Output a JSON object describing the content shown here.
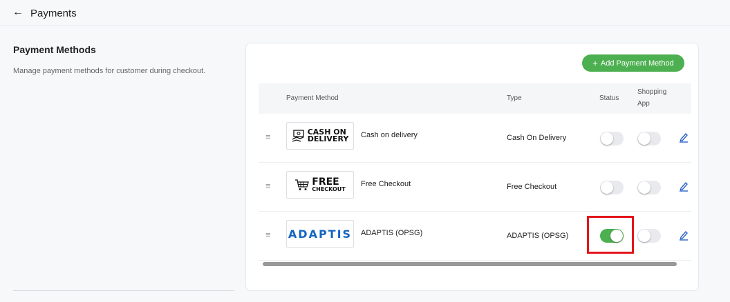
{
  "header": {
    "back_icon": "arrow-left-icon",
    "title": "Payments"
  },
  "sidebar": {
    "title": "Payment Methods",
    "description": "Manage payment methods for customer during checkout."
  },
  "toolbar": {
    "add_label": "Add Payment Method",
    "add_icon": "plus-icon"
  },
  "table": {
    "headers": {
      "method": "Payment Method",
      "type": "Type",
      "status": "Status",
      "shopping_app_line1": "Shopping",
      "shopping_app_line2": "App"
    },
    "rows": [
      {
        "logo_line1": "CASH ON",
        "logo_line2": "DELIVERY",
        "name": "Cash on delivery",
        "type": "Cash On Delivery",
        "status": false,
        "shopping_app": false
      },
      {
        "logo_line1": "FREE",
        "logo_line2": "CHECKOUT",
        "name": "Free Checkout",
        "type": "Free Checkout",
        "status": false,
        "shopping_app": false
      },
      {
        "logo_line1": "ADAPTIS",
        "name": "ADAPTIS (OPSG)",
        "type": "ADAPTIS (OPSG)",
        "status": true,
        "shopping_app": false
      }
    ]
  },
  "colors": {
    "accent": "#4caf50",
    "highlight": "#e3161b",
    "adaptis_blue": "#1565c0"
  }
}
